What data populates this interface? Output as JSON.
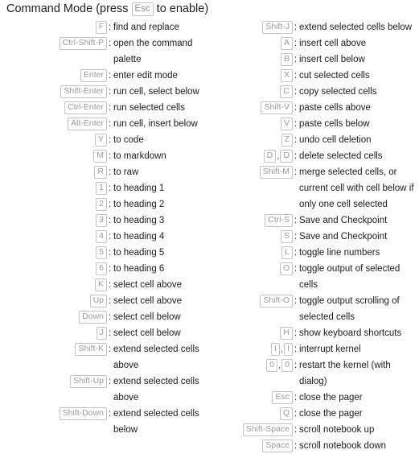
{
  "header": {
    "text_before": "Command Mode (press",
    "key": "Esc",
    "text_after": "to enable)"
  },
  "separator": ",",
  "colon": ":",
  "columns": {
    "left": [
      {
        "keys": [
          "F"
        ],
        "desc": "find and replace"
      },
      {
        "keys": [
          "Ctrl-Shift-P"
        ],
        "desc": "open the command palette"
      },
      {
        "keys": [
          "Enter"
        ],
        "desc": "enter edit mode"
      },
      {
        "keys": [
          "Shift-Enter"
        ],
        "desc": "run cell, select below"
      },
      {
        "keys": [
          "Ctrl-Enter"
        ],
        "desc": "run selected cells"
      },
      {
        "keys": [
          "Alt-Enter"
        ],
        "desc": "run cell, insert below"
      },
      {
        "keys": [
          "Y"
        ],
        "desc": "to code"
      },
      {
        "keys": [
          "M"
        ],
        "desc": "to markdown"
      },
      {
        "keys": [
          "R"
        ],
        "desc": "to raw"
      },
      {
        "keys": [
          "1"
        ],
        "desc": "to heading 1"
      },
      {
        "keys": [
          "2"
        ],
        "desc": "to heading 2"
      },
      {
        "keys": [
          "3"
        ],
        "desc": "to heading 3"
      },
      {
        "keys": [
          "4"
        ],
        "desc": "to heading 4"
      },
      {
        "keys": [
          "5"
        ],
        "desc": "to heading 5"
      },
      {
        "keys": [
          "6"
        ],
        "desc": "to heading 6"
      },
      {
        "keys": [
          "K"
        ],
        "desc": "select cell above"
      },
      {
        "keys": [
          "Up"
        ],
        "desc": "select cell above"
      },
      {
        "keys": [
          "Down"
        ],
        "desc": "select cell below"
      },
      {
        "keys": [
          "J"
        ],
        "desc": "select cell below"
      },
      {
        "keys": [
          "Shift-K"
        ],
        "desc": "extend selected cells above"
      },
      {
        "keys": [
          "Shift-Up"
        ],
        "desc": "extend selected cells above"
      },
      {
        "keys": [
          "Shift-Down"
        ],
        "desc": "extend selected cells below"
      }
    ],
    "right": [
      {
        "keys": [
          "Shift-J"
        ],
        "desc": "extend selected cells below"
      },
      {
        "keys": [
          "A"
        ],
        "desc": "insert cell above"
      },
      {
        "keys": [
          "B"
        ],
        "desc": "insert cell below"
      },
      {
        "keys": [
          "X"
        ],
        "desc": "cut selected cells"
      },
      {
        "keys": [
          "C"
        ],
        "desc": "copy selected cells"
      },
      {
        "keys": [
          "Shift-V"
        ],
        "desc": "paste cells above"
      },
      {
        "keys": [
          "V"
        ],
        "desc": "paste cells below"
      },
      {
        "keys": [
          "Z"
        ],
        "desc": "undo cell deletion"
      },
      {
        "keys": [
          "D",
          "D"
        ],
        "desc": "delete selected cells"
      },
      {
        "keys": [
          "Shift-M"
        ],
        "desc": "merge selected cells, or current cell with cell below if only one cell selected"
      },
      {
        "keys": [
          "Ctrl-S"
        ],
        "desc": "Save and Checkpoint"
      },
      {
        "keys": [
          "S"
        ],
        "desc": "Save and Checkpoint"
      },
      {
        "keys": [
          "L"
        ],
        "desc": "toggle line numbers"
      },
      {
        "keys": [
          "O"
        ],
        "desc": "toggle output of selected cells"
      },
      {
        "keys": [
          "Shift-O"
        ],
        "desc": "toggle output scrolling of selected cells"
      },
      {
        "keys": [
          "H"
        ],
        "desc": "show keyboard shortcuts"
      },
      {
        "keys": [
          "I",
          "I"
        ],
        "desc": "interrupt kernel"
      },
      {
        "keys": [
          "0",
          "0"
        ],
        "desc": "restart the kernel (with dialog)"
      },
      {
        "keys": [
          "Esc"
        ],
        "desc": "close the pager"
      },
      {
        "keys": [
          "Q"
        ],
        "desc": "close the pager"
      },
      {
        "keys": [
          "Shift-Space"
        ],
        "desc": "scroll notebook up"
      },
      {
        "keys": [
          "Space"
        ],
        "desc": "scroll notebook down"
      }
    ]
  }
}
